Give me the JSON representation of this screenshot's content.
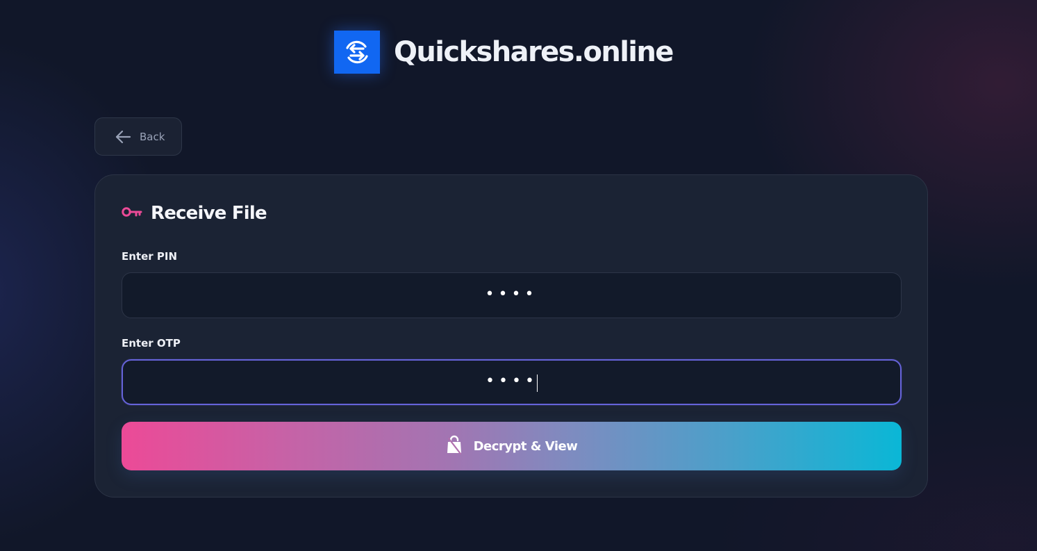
{
  "header": {
    "app_name": "Quickshares.online",
    "logo_icon": "exchange-arrows-icon",
    "accent_color": "#1167f2"
  },
  "back_button": {
    "label": "Back",
    "icon": "arrow-left-icon"
  },
  "card": {
    "title": "Receive File",
    "title_icon": "key-icon",
    "title_icon_color": "#ec4a97",
    "pin": {
      "label": "Enter PIN",
      "masked_value": "••••"
    },
    "otp": {
      "label": "Enter OTP",
      "masked_value": "••••",
      "focused": true
    },
    "submit": {
      "label": "Decrypt & View",
      "icon": "unlocked-bag-icon"
    }
  }
}
